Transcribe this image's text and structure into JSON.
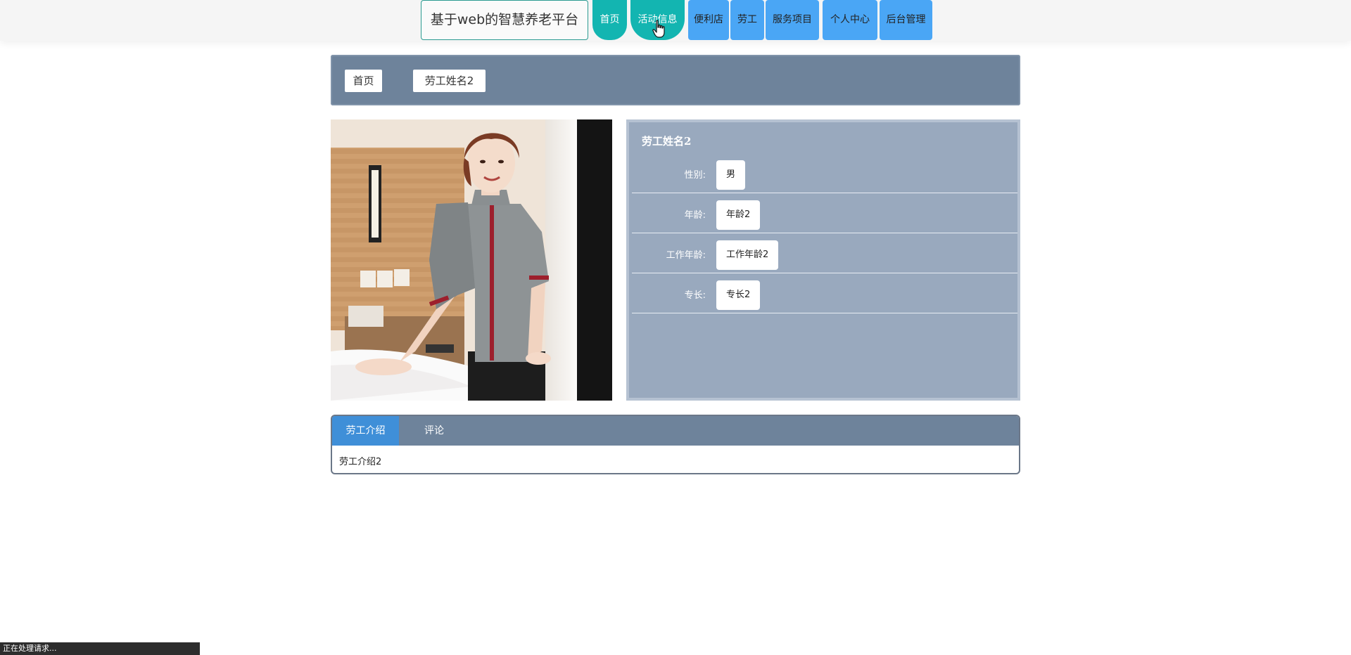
{
  "nav": {
    "brand": "基于web的智慧养老平台",
    "items": [
      {
        "label": "首页"
      },
      {
        "label": "活动信息"
      },
      {
        "label": "便利店"
      },
      {
        "label": "劳工"
      },
      {
        "label": "服务项目"
      },
      {
        "label": "个人中心"
      },
      {
        "label": "后台管理"
      }
    ]
  },
  "breadcrumb": {
    "home": "首页",
    "current": "劳工姓名2"
  },
  "detail": {
    "title": "劳工姓名2",
    "rows": [
      {
        "label": "性别:",
        "value": "男"
      },
      {
        "label": "年龄:",
        "value": "年龄2"
      },
      {
        "label": "工作年龄:",
        "value": "工作年龄2"
      },
      {
        "label": "专长:",
        "value": "专长2"
      }
    ]
  },
  "tabs": {
    "items": [
      {
        "label": "劳工介绍",
        "active": true
      },
      {
        "label": "评论",
        "active": false
      }
    ],
    "content": "劳工介绍2"
  },
  "status_bar": "正在处理请求...",
  "colors": {
    "nav_active": "#13b5b1",
    "nav_button": "#4aa6f5",
    "panel_dark": "#6e839b",
    "panel_light": "#99a9be",
    "tab_active": "#3f8fd8"
  }
}
